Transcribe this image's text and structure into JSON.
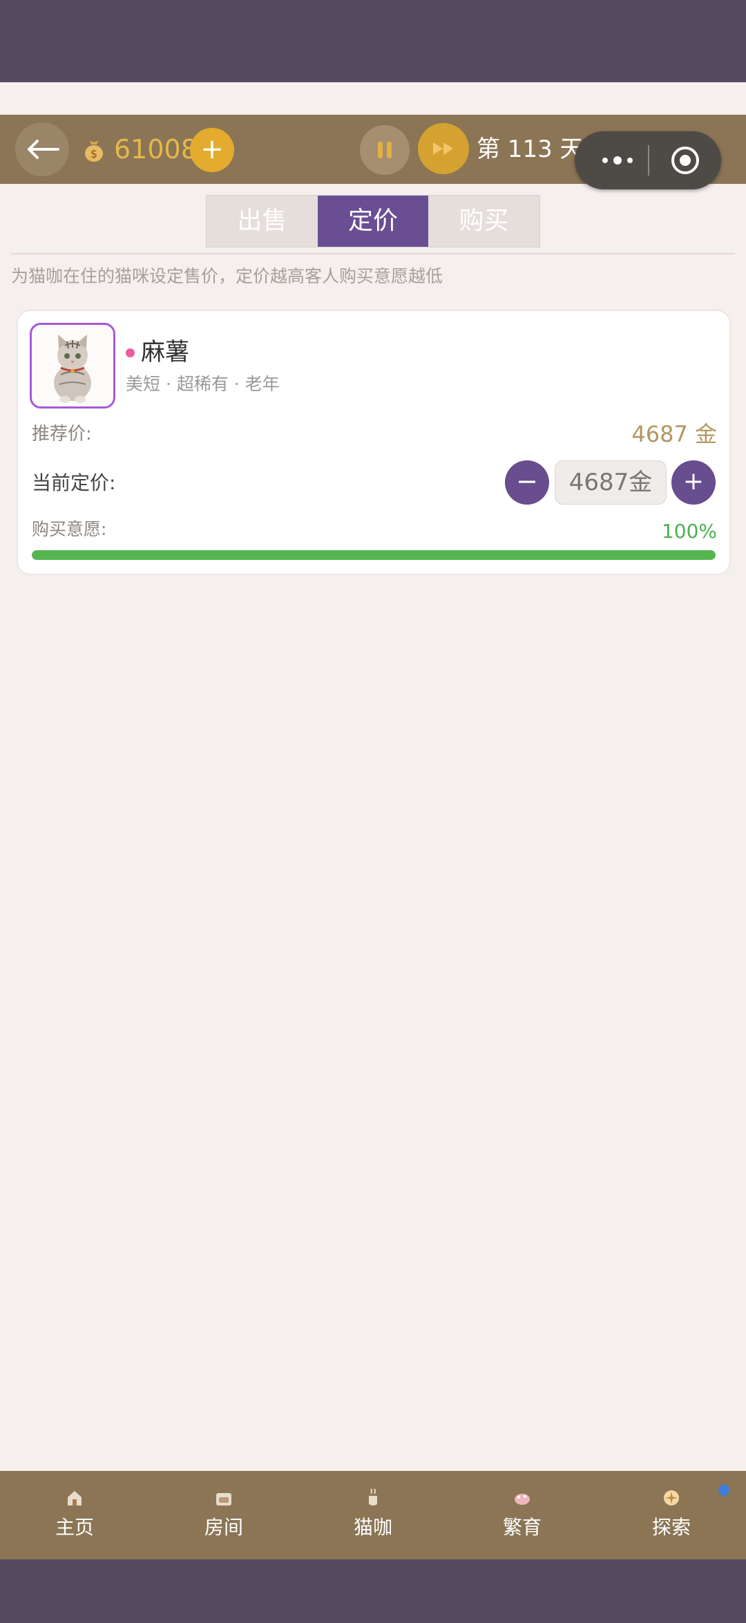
{
  "header": {
    "coins": "61008",
    "add_coin_label": "+",
    "day_label": "第 113 天"
  },
  "tabs": [
    {
      "label": "出售",
      "active": false
    },
    {
      "label": "定价",
      "active": true
    },
    {
      "label": "购买",
      "active": false
    }
  ],
  "hint": "为猫咖在住的猫咪设定售价，定价越高客人购买意愿越低",
  "cat": {
    "name": "麻薯",
    "tags": "美短 · 超稀有 · 老年",
    "recommended_label": "推荐价:",
    "recommended_value": "4687 金",
    "current_label": "当前定价:",
    "decrease_label": "−",
    "current_value": "4687金",
    "increase_label": "+",
    "willingness_label": "购买意愿:",
    "willingness_value": "100%",
    "willingness_fraction": 1.0
  },
  "nav": [
    {
      "label": "主页",
      "icon": "home-icon"
    },
    {
      "label": "房间",
      "icon": "room-icon"
    },
    {
      "label": "猫咖",
      "icon": "cafe-icon"
    },
    {
      "label": "繁育",
      "icon": "breeding-icon"
    },
    {
      "label": "探索",
      "icon": "explore-icon"
    }
  ],
  "colors": {
    "topbar": "#8b7555",
    "accent_purple": "#684d8f",
    "gold": "#e3ac2f",
    "progress_green": "#55b551"
  }
}
